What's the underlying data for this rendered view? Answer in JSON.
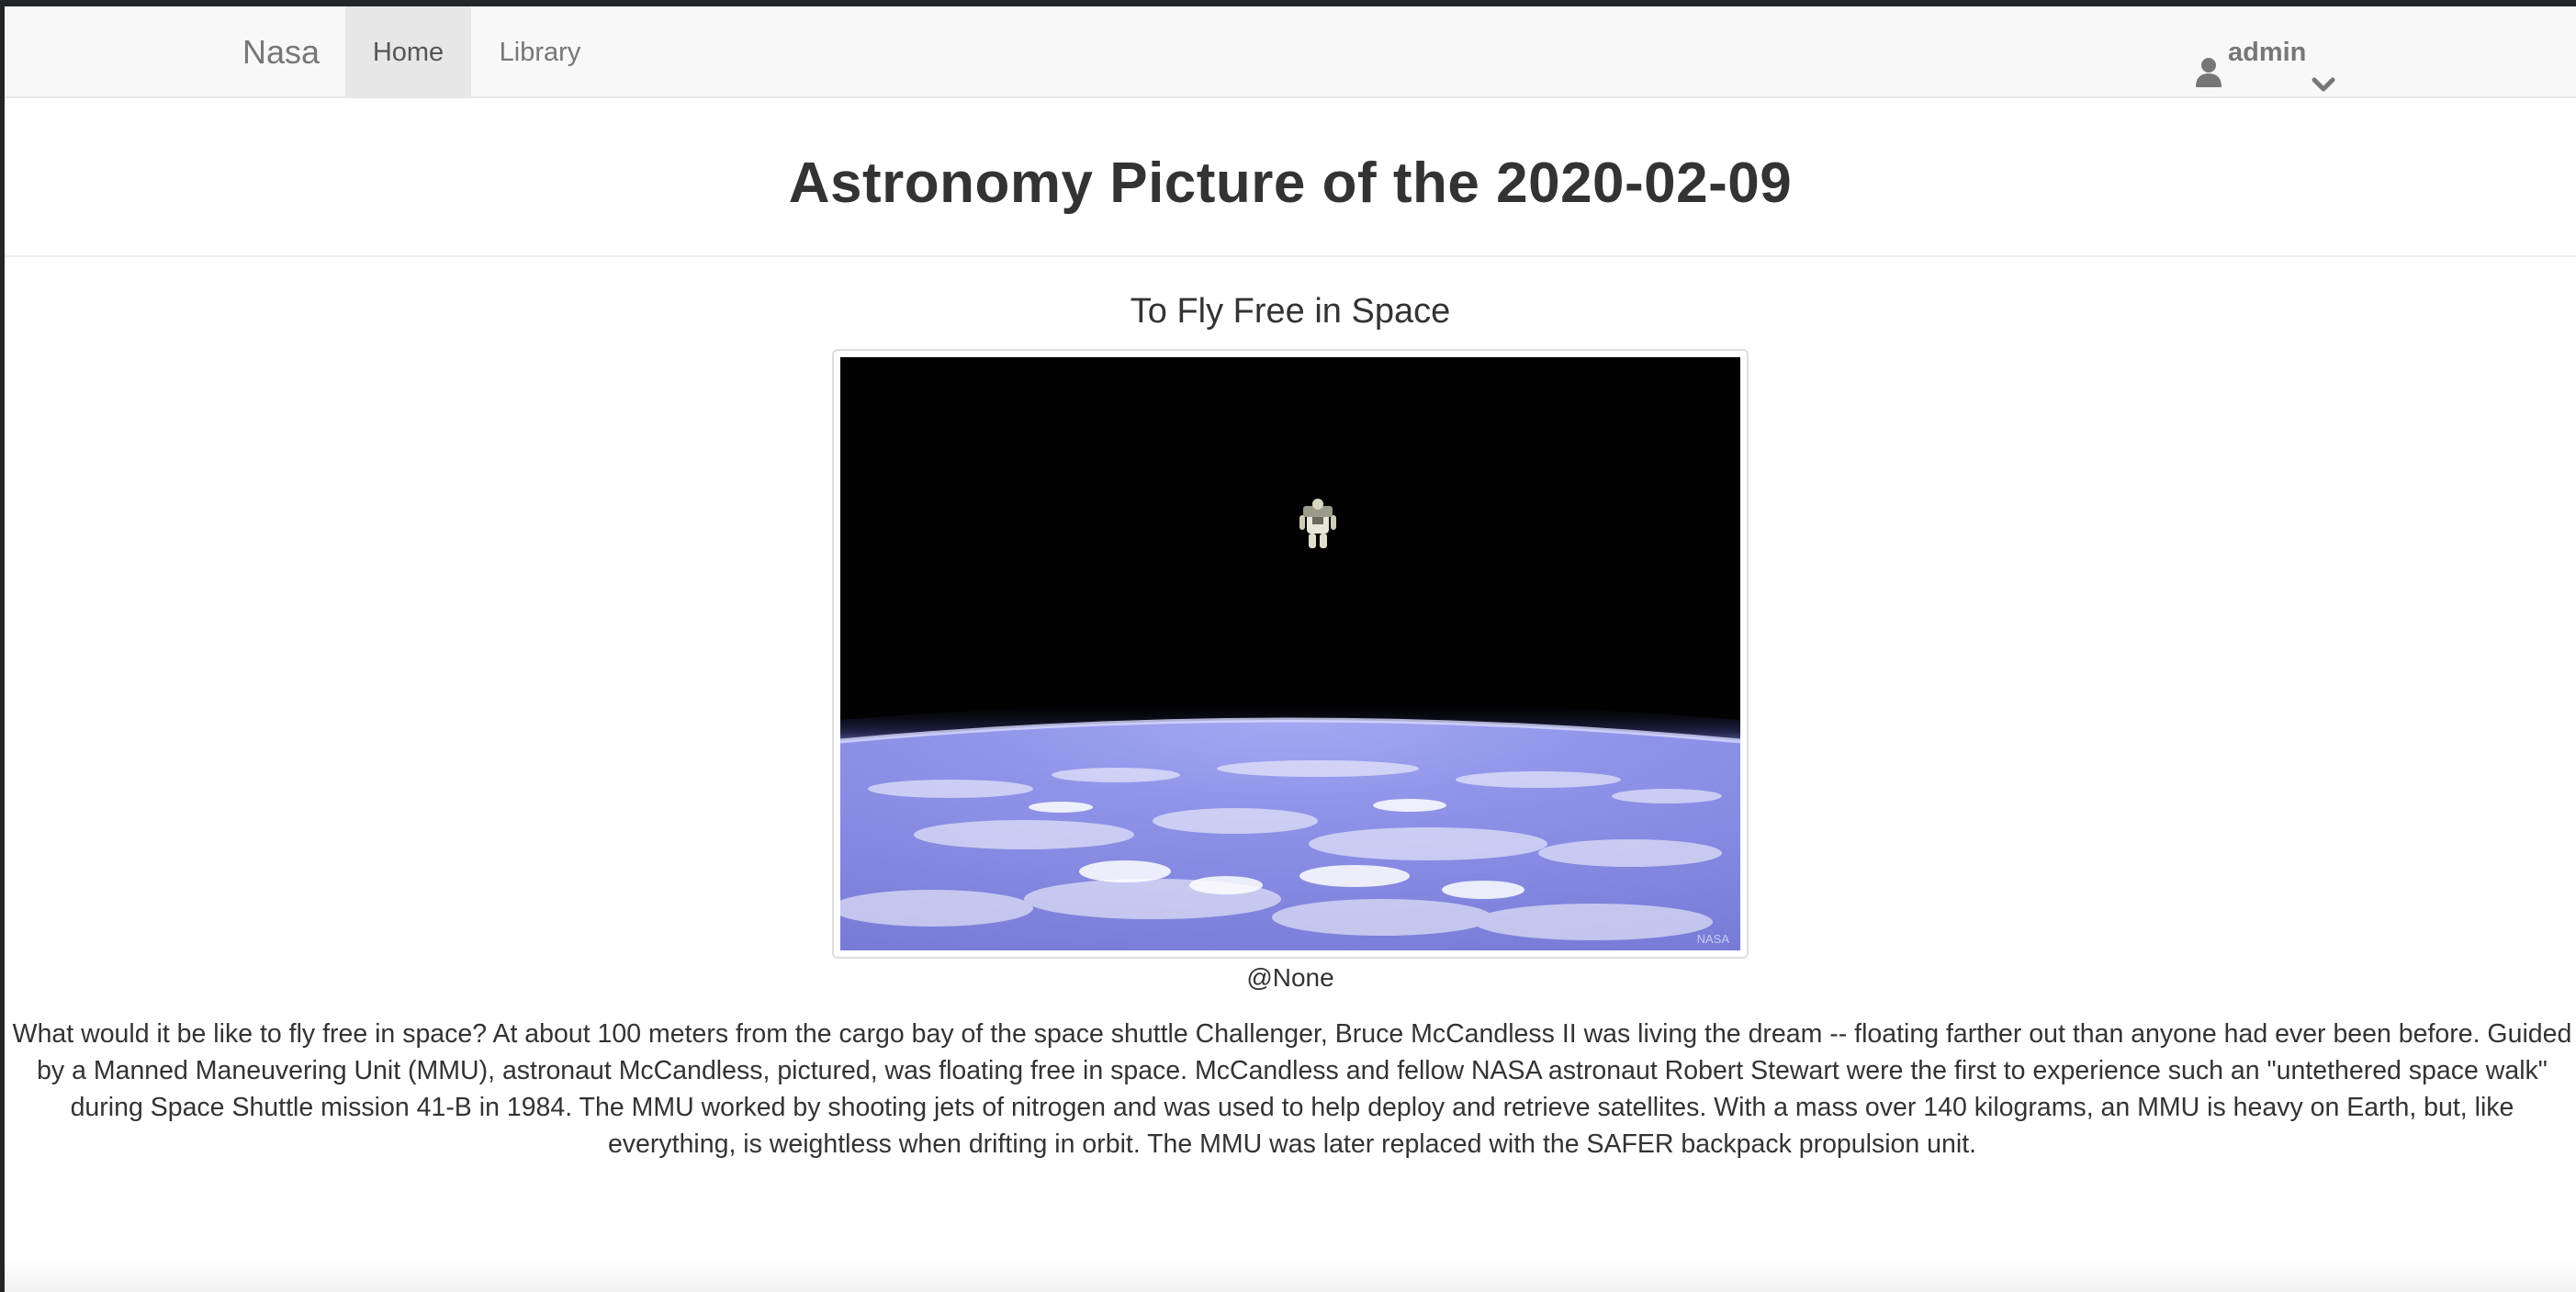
{
  "navbar": {
    "brand": "Nasa",
    "items": [
      {
        "label": "Home",
        "active": true
      },
      {
        "label": "Library",
        "active": false
      }
    ],
    "user": {
      "name": "admin",
      "icon": "user-icon",
      "dropdown_icon": "chevron-down-icon"
    }
  },
  "header": {
    "title": "Astronomy Picture of the 2020-02-09"
  },
  "apod": {
    "title": "To Fly Free in Space",
    "image_alt": "To Fly Free in Space",
    "image_watermark": "NASA",
    "credit": "@None",
    "explanation": "What would it be like to fly free in space? At about 100 meters from the cargo bay of the space shuttle Challenger, Bruce McCandless II was living the dream -- floating farther out than anyone had ever been before. Guided by a Manned Maneuvering Unit (MMU), astronaut McCandless, pictured, was floating free in space. McCandless and fellow NASA astronaut Robert Stewart were the first to experience such an \"untethered space walk\" during Space Shuttle mission 41-B in 1984. The MMU worked by shooting jets of nitrogen and was used to help deploy and retrieve satellites. With a mass over 140 kilograms, an MMU is heavy on Earth, but, like everything, is weightless when drifting in orbit. The MMU was later replaced with the SAFER backpack propulsion unit."
  },
  "colors": {
    "navbar_bg": "#f8f8f8",
    "active_tab_bg": "#e7e7e7",
    "nav_text": "#777777",
    "body_text": "#333333",
    "earth_blue": "#8a8fe6"
  }
}
